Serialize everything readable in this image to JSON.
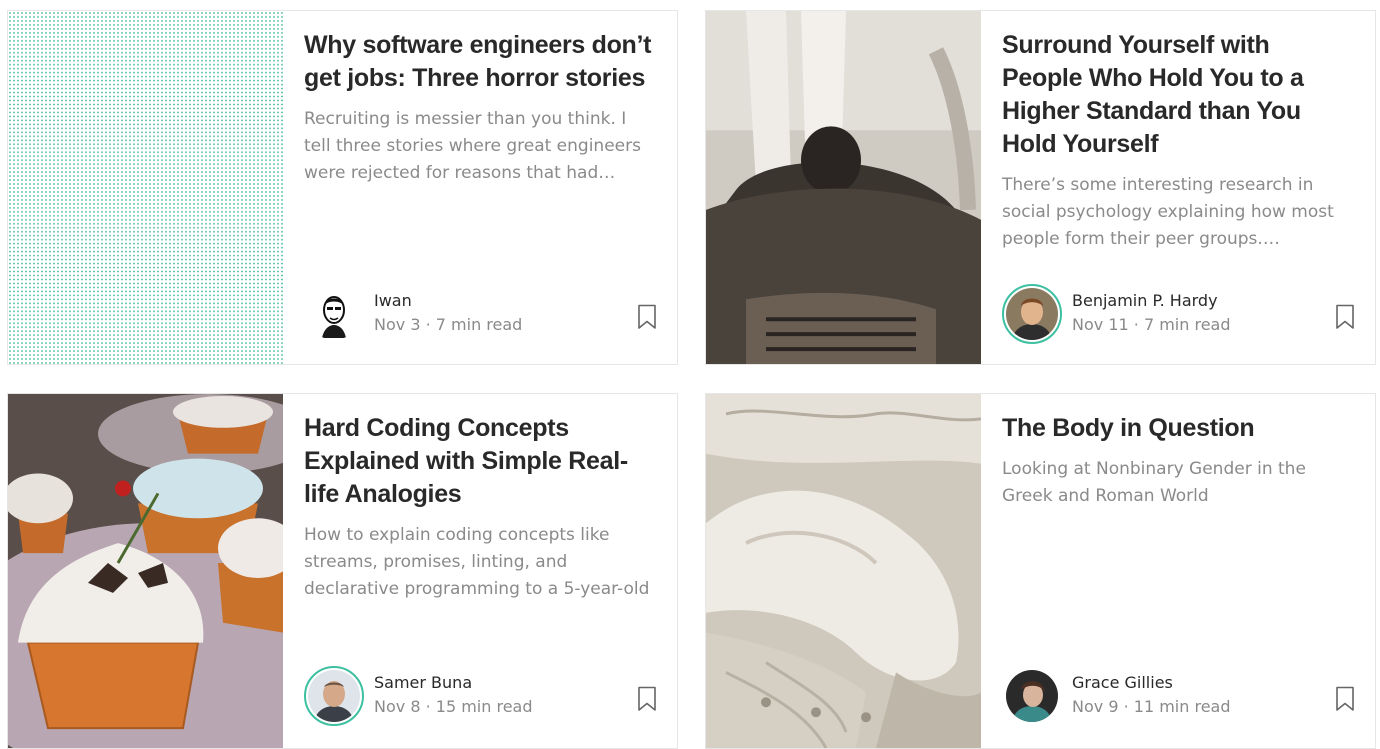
{
  "cards": [
    {
      "title": "Why software engineers don’t get jobs: Three horror stories",
      "subtitle": "Recruiting is messier than you think. I tell three stories where great engineers were rejected for reasons that had…",
      "author": "Iwan",
      "date": "Nov 3",
      "read_time": "7 min read"
    },
    {
      "title": "Surround Yourself with People Who Hold You to a Higher Standard than You Hold Yourself",
      "subtitle": "There’s some interesting research in social psychology explaining how most people form their peer groups.…",
      "author": "Benjamin P. Hardy",
      "date": "Nov 11",
      "read_time": "7 min read"
    },
    {
      "title": "Hard Coding Concepts Explained with Simple Real-life Analogies",
      "subtitle": "How to explain coding concepts like streams, promises, linting, and declarative programming to a 5-year-old",
      "author": "Samer Buna",
      "date": "Nov 8",
      "read_time": "15 min read"
    },
    {
      "title": "The Body in Question",
      "subtitle": "Looking at Nonbinary Gender in the Greek and Roman World",
      "author": "Grace Gillies",
      "date": "Nov 9",
      "read_time": "11 min read"
    }
  ],
  "separator": " · ",
  "icons": {
    "bookmark": "bookmark-icon"
  },
  "colors": {
    "title": "#292929",
    "subtitle": "#8a8a8a",
    "accent": "#3cc0a0",
    "border": "#e6e6e6"
  }
}
